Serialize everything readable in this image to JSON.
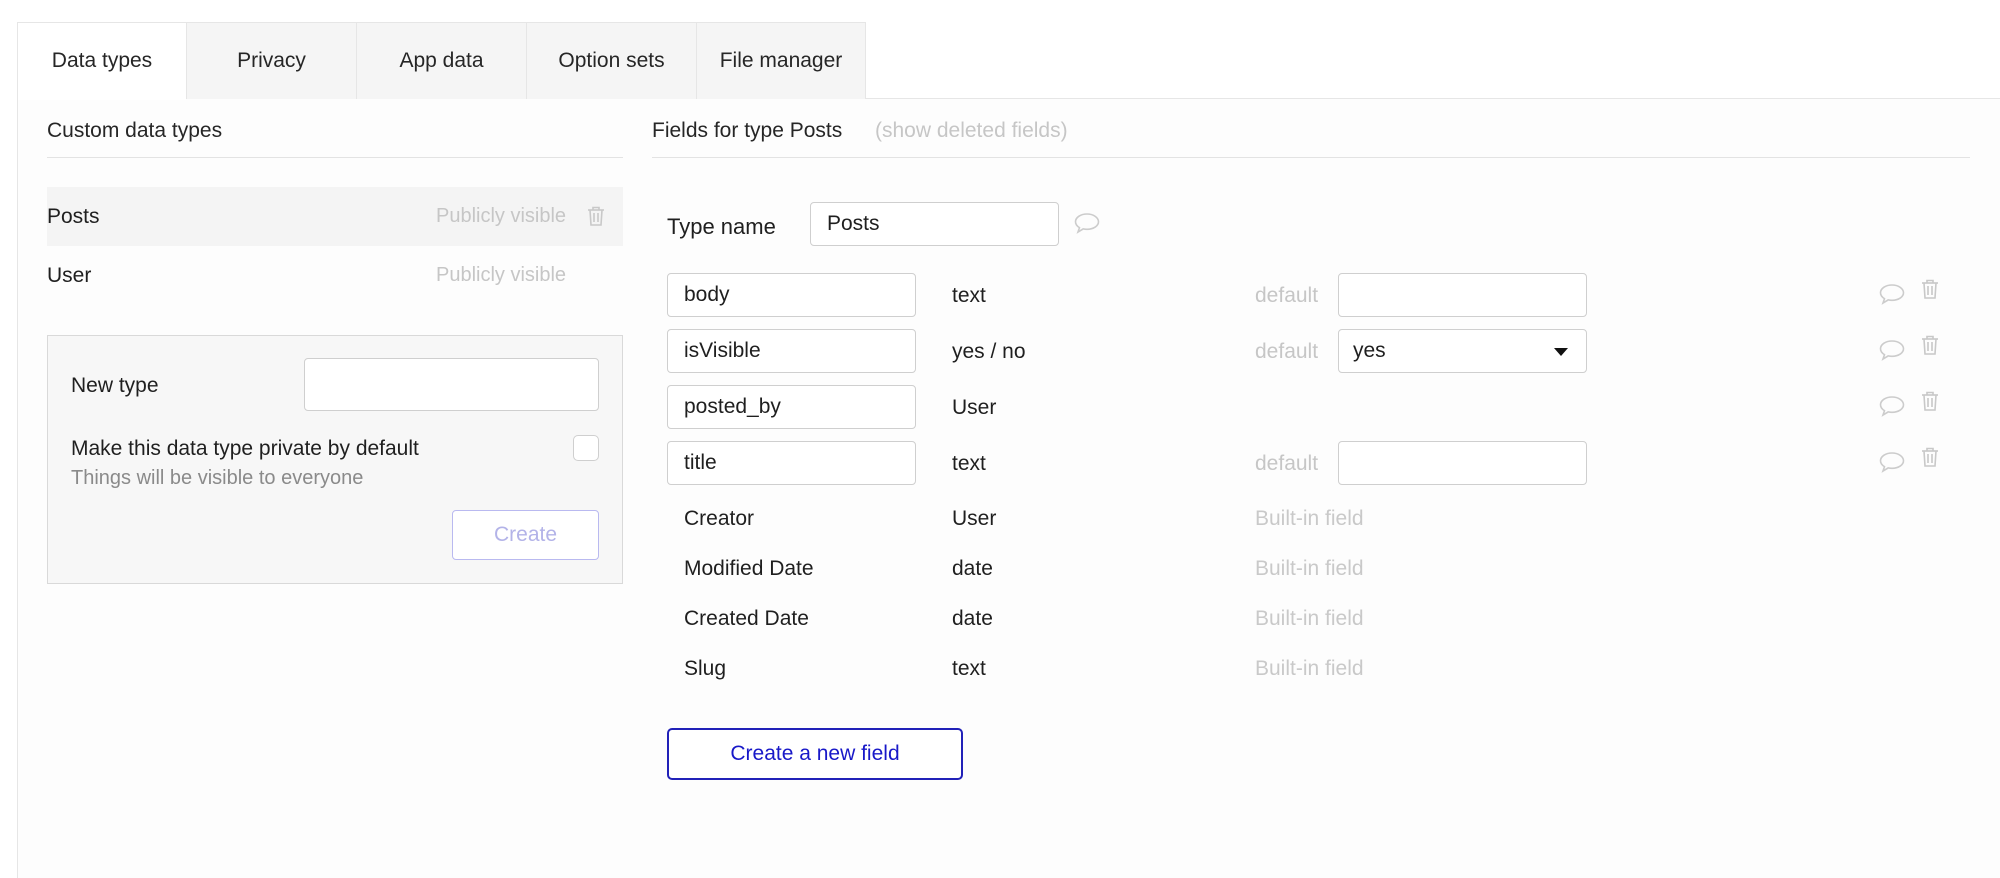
{
  "tabs": [
    {
      "label": "Data types",
      "active": true
    },
    {
      "label": "Privacy"
    },
    {
      "label": "App data"
    },
    {
      "label": "Option sets"
    },
    {
      "label": "File manager"
    }
  ],
  "left": {
    "title": "Custom data types",
    "types": [
      {
        "name": "Posts",
        "visibility": "Publicly visible",
        "selected": true
      },
      {
        "name": "User",
        "visibility": "Publicly visible"
      }
    ],
    "new_type": {
      "label": "New type",
      "value": "",
      "private_label": "Make this data type private by default",
      "private_hint": "Things will be visible to everyone",
      "create_label": "Create"
    }
  },
  "right": {
    "title": "Fields for type Posts",
    "show_deleted": "(show deleted fields)",
    "type_name_label": "Type name",
    "type_name_value": "Posts",
    "default_label": "default",
    "fields": [
      {
        "name": "body",
        "type": "text",
        "default": ""
      },
      {
        "name": "isVisible",
        "type": "yes / no",
        "default": "yes"
      },
      {
        "name": "posted_by",
        "type": "User"
      },
      {
        "name": "title",
        "type": "text",
        "default": ""
      }
    ],
    "builtin_label": "Built-in field",
    "builtin_fields": [
      {
        "name": "Creator",
        "type": "User"
      },
      {
        "name": "Modified Date",
        "type": "date"
      },
      {
        "name": "Created Date",
        "type": "date"
      },
      {
        "name": "Slug",
        "type": "text"
      }
    ],
    "create_field_label": "Create a new field"
  },
  "colors": {
    "accent": "#1818c8",
    "muted": "#c6c6c6"
  }
}
